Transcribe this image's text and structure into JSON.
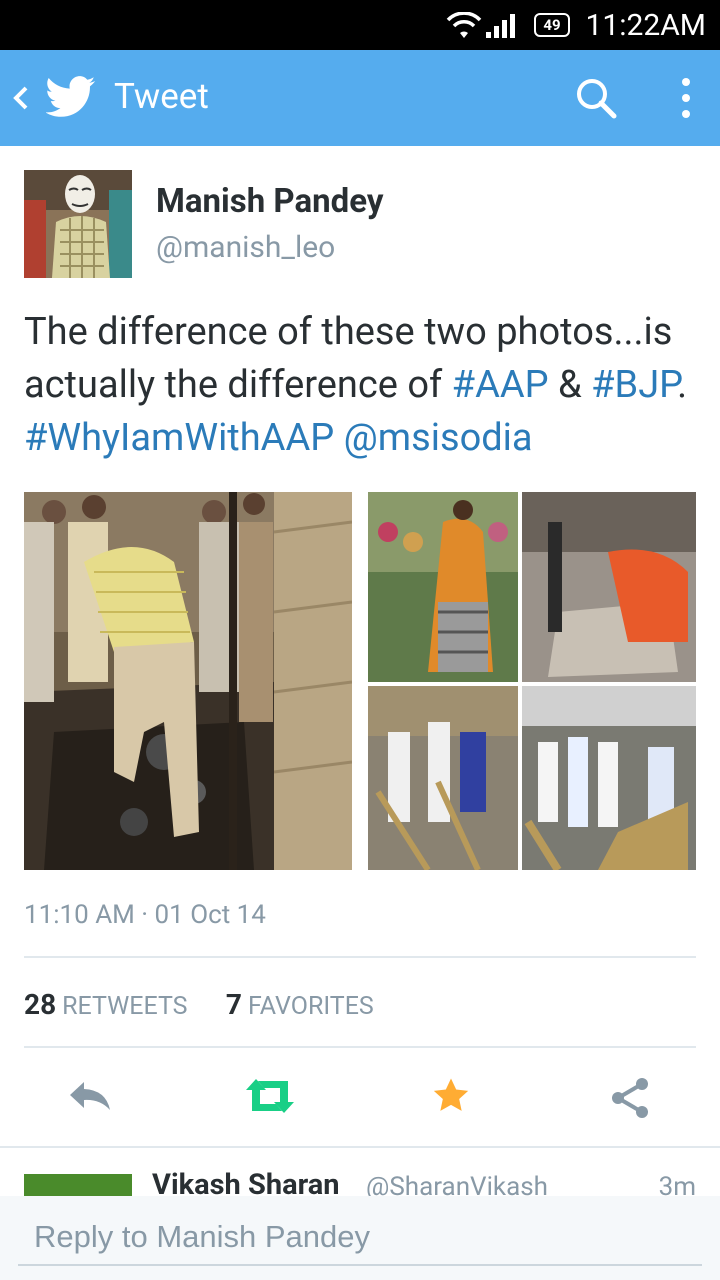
{
  "status": {
    "battery": "49",
    "time": "11:22AM"
  },
  "appbar": {
    "title": "Tweet"
  },
  "tweet": {
    "name": "Manish Pandey",
    "handle": "@manish_leo",
    "text_plain1": "The difference of these two photos...is actually the difference of ",
    "hashtag1": "#AAP",
    "amp": " & ",
    "hashtag2": "#BJP",
    "dot": ". ",
    "hashtag3": "#WhyIamWithAAP",
    "space": " ",
    "mention": "@msisodia",
    "meta": "11:10 AM · 01 Oct 14",
    "retweets_count": "28",
    "retweets_label": "RETWEETS",
    "favorites_count": "7",
    "favorites_label": "FAVORITES"
  },
  "reply_preview": {
    "name": "Vikash Sharan",
    "handle": "@SharanVikash",
    "time": "3m"
  },
  "composer": {
    "placeholder": "Reply to Manish Pandey"
  },
  "colors": {
    "appbar": "#55acee",
    "link": "#2b7bb9",
    "retweet": "#19cf86",
    "favorite": "#ffac33"
  },
  "icons": [
    "back-icon",
    "twitter-bird-icon",
    "search-icon",
    "more-icon",
    "reply-icon",
    "retweet-icon",
    "favorite-icon",
    "share-icon"
  ]
}
